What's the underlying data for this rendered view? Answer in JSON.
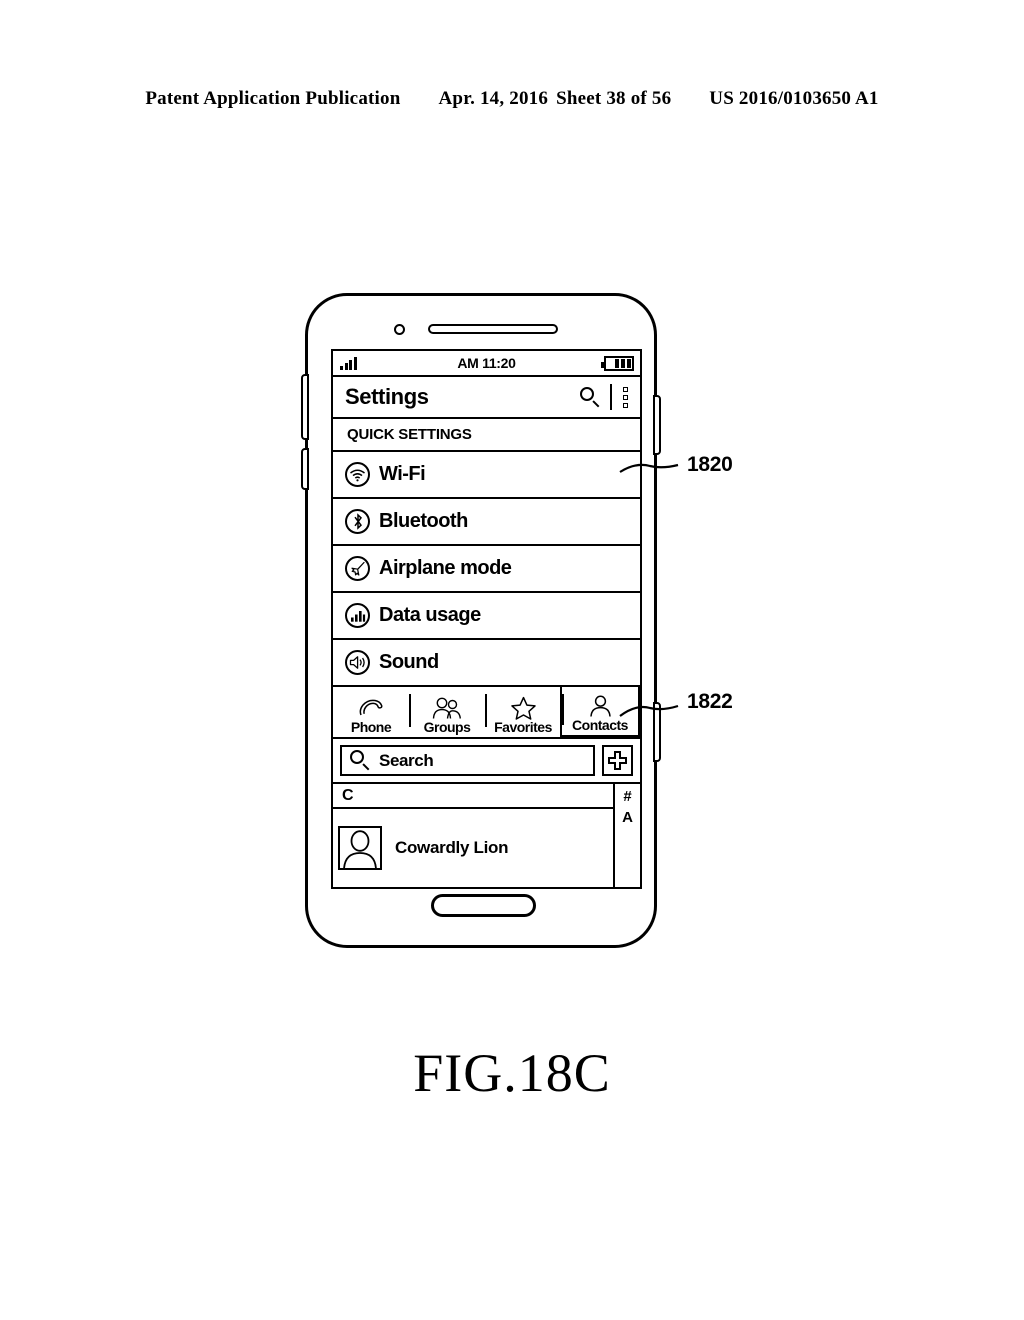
{
  "page_header": {
    "publication": "Patent Application Publication",
    "date": "Apr. 14, 2016",
    "sheet": "Sheet 38 of 56",
    "patent_number": "US 2016/0103650 A1"
  },
  "figure": {
    "caption": "FIG.18C",
    "callouts": [
      {
        "id": "1820",
        "label": "1820",
        "points_to": "wi-fi-settings-row"
      },
      {
        "id": "1822",
        "label": "1822",
        "points_to": "contacts-tab-bar"
      }
    ]
  },
  "device": {
    "status_bar": {
      "signal_icon": "signal-bars-icon",
      "time": "AM 11:20",
      "battery_icon": "battery-icon",
      "battery_bars": 3
    },
    "title_bar": {
      "title": "Settings",
      "search_icon": "search-icon",
      "menu_icon": "overflow-menu-icon"
    },
    "quick_settings": {
      "section_label": "QUICK SETTINGS",
      "items": [
        {
          "label": "Wi-Fi",
          "icon": "wifi-icon"
        },
        {
          "label": "Bluetooth",
          "icon": "bluetooth-icon"
        },
        {
          "label": "Airplane mode",
          "icon": "airplane-icon"
        },
        {
          "label": "Data usage",
          "icon": "bar-chart-icon"
        },
        {
          "label": "Sound",
          "icon": "speaker-icon"
        }
      ]
    },
    "tab_bar": {
      "tabs": [
        {
          "label": "Phone",
          "icon": "phone-handset-icon",
          "selected": false
        },
        {
          "label": "Groups",
          "icon": "group-people-icon",
          "selected": false
        },
        {
          "label": "Favorites",
          "icon": "star-icon",
          "selected": false
        },
        {
          "label": "Contacts",
          "icon": "person-icon",
          "selected": true
        }
      ]
    },
    "search": {
      "placeholder": "Search",
      "icon": "search-icon",
      "add_button_icon": "plus-icon"
    },
    "contacts": {
      "group_header": "C",
      "rows": [
        {
          "name": "Cowardly Lion",
          "avatar_icon": "person-avatar-icon"
        }
      ],
      "index": [
        "#",
        "A"
      ]
    }
  }
}
